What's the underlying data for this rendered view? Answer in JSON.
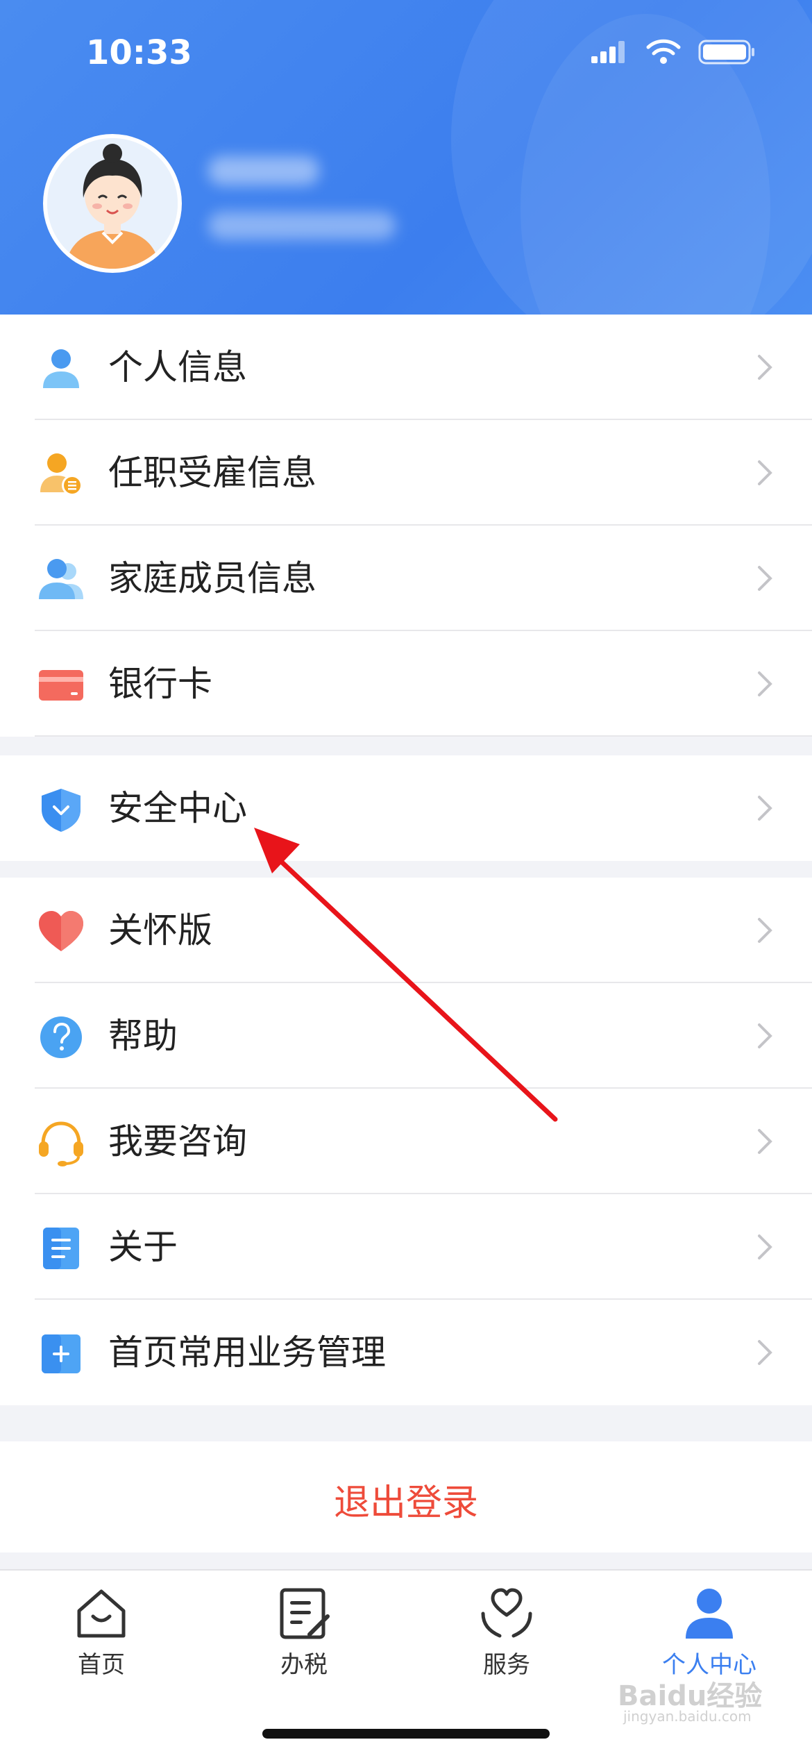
{
  "status_bar": {
    "time": "10:33"
  },
  "menu_group_1": [
    {
      "label": "个人信息",
      "icon": "person-icon"
    },
    {
      "label": "任职受雇信息",
      "icon": "employment-icon"
    },
    {
      "label": "家庭成员信息",
      "icon": "family-icon"
    },
    {
      "label": "银行卡",
      "icon": "bank-card-icon"
    }
  ],
  "menu_group_2": [
    {
      "label": "安全中心",
      "icon": "shield-icon"
    }
  ],
  "menu_group_3": [
    {
      "label": "关怀版",
      "icon": "heart-icon"
    },
    {
      "label": "帮助",
      "icon": "help-icon"
    },
    {
      "label": "我要咨询",
      "icon": "headset-icon"
    },
    {
      "label": "关于",
      "icon": "document-icon"
    },
    {
      "label": "首页常用业务管理",
      "icon": "plus-square-icon"
    }
  ],
  "logout_label": "退出登录",
  "tabbar": [
    {
      "label": "首页",
      "icon": "home-icon"
    },
    {
      "label": "办税",
      "icon": "tax-form-icon"
    },
    {
      "label": "服务",
      "icon": "service-heart-icon"
    },
    {
      "label": "个人中心",
      "icon": "profile-icon",
      "active": true
    }
  ],
  "watermark": {
    "brand": "Baidu经验",
    "domain": "jingyan.baidu.com"
  },
  "colors": {
    "header_blue": "#4a8cf0",
    "accent": "#3b7ff0",
    "logout_red": "#ee4b3a",
    "arrow_red": "#e8141a"
  }
}
